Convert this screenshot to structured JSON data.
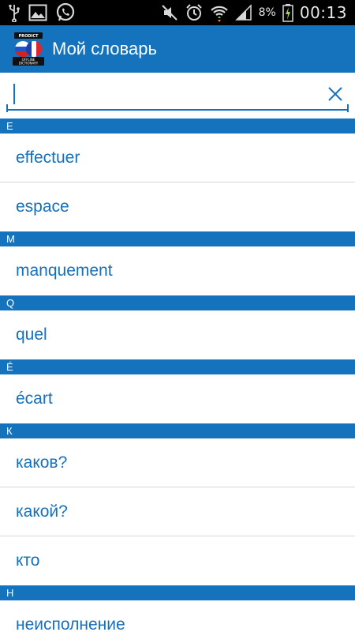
{
  "status_bar": {
    "battery_text": "8%",
    "clock": "00:13",
    "icons": [
      "usb-icon",
      "gallery-icon",
      "whatsapp-icon",
      "mute-icon",
      "alarm-icon",
      "wifi-icon",
      "signal-icon",
      "battery-charging-icon"
    ]
  },
  "app_bar": {
    "title": "Мой словарь",
    "logo_top_text": "PRODICT",
    "logo_bottom_text": "OFFLINE DICTIONARY",
    "accent": "#1473bc"
  },
  "search": {
    "value": "",
    "placeholder": ""
  },
  "sections": [
    {
      "letter": "E",
      "words": [
        "effectuer",
        "espace"
      ]
    },
    {
      "letter": "M",
      "words": [
        "manquement"
      ]
    },
    {
      "letter": "Q",
      "words": [
        "quel"
      ]
    },
    {
      "letter": "É",
      "words": [
        "écart"
      ]
    },
    {
      "letter": "К",
      "words": [
        "каков?",
        "какой?",
        "кто"
      ]
    },
    {
      "letter": "Н",
      "words": [
        "неисполнение"
      ]
    }
  ]
}
